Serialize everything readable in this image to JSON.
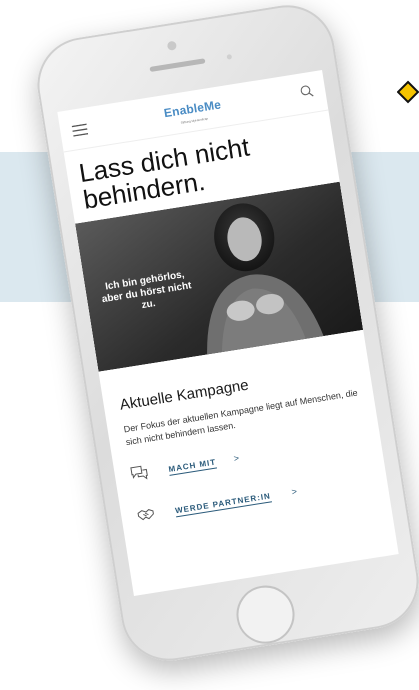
{
  "brand": {
    "logo": "EnableMe",
    "logo_sub": "Stiftung MyHandicap"
  },
  "header": {
    "menu_icon": "hamburger-menu-icon",
    "search_icon": "search-icon"
  },
  "hero": {
    "title_line1": "Lass dich nicht",
    "title_line2": "behindern.",
    "caption": "Ich bin gehörlos, aber du hörst nicht zu."
  },
  "campaign": {
    "title": "Aktuelle Kampagne",
    "text": "Der Fokus der aktuellen Kampagne liegt auf Menschen, die sich nicht behindern lassen."
  },
  "actions": [
    {
      "icon": "chat-bubbles-icon",
      "label": "MACH MIT",
      "arrow": ">"
    },
    {
      "icon": "handshake-icon",
      "label": "WERDE PARTNER:IN",
      "arrow": ">"
    }
  ],
  "colors": {
    "band": "#dbe8ef",
    "logo_blue": "#4a8cc4",
    "link": "#2a5a7a"
  }
}
